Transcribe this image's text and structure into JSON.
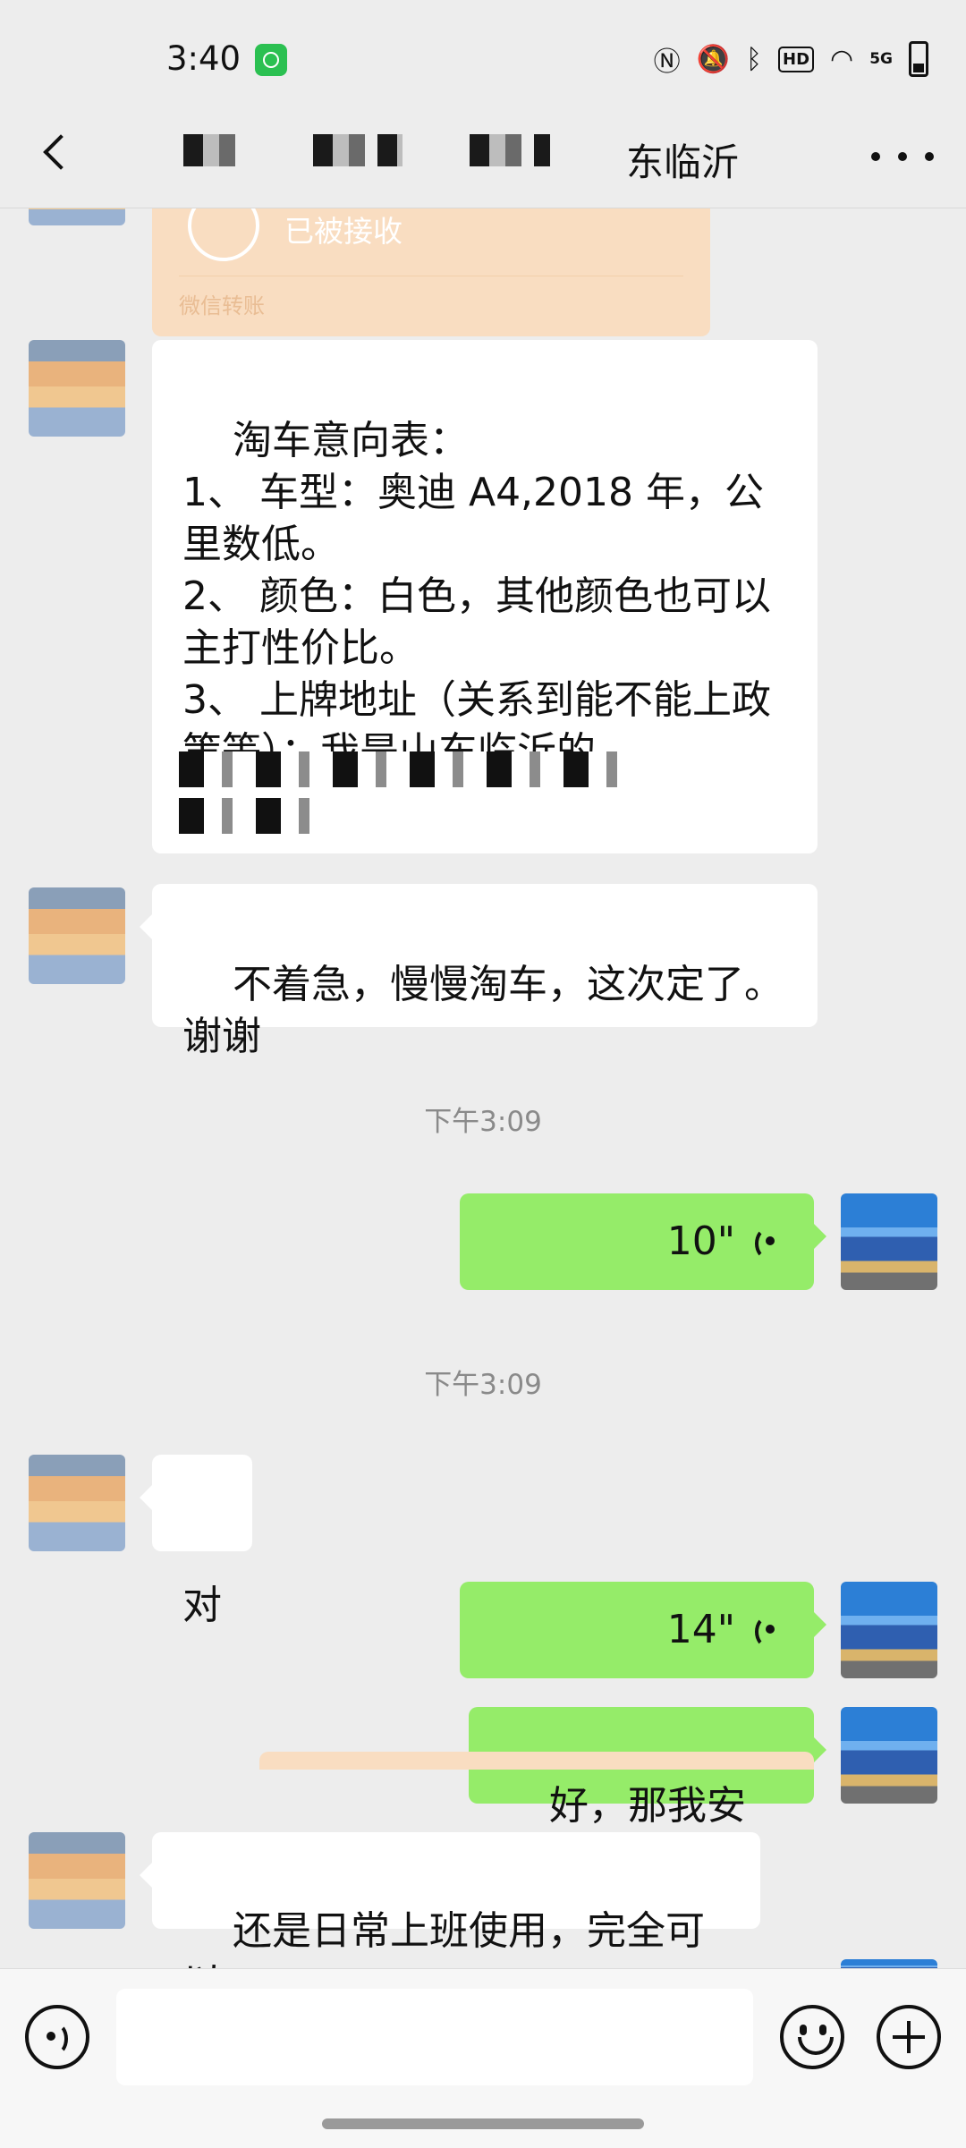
{
  "status_bar": {
    "time": "3:40",
    "icons": [
      "nfc-icon",
      "mute-icon",
      "bluetooth-icon",
      "hd-icon",
      "wifi-icon",
      "5g-signal-icon",
      "battery-icon"
    ],
    "hd": "HD",
    "network": "5G"
  },
  "header": {
    "title_visible": "东临沂",
    "back": "back-arrow-icon",
    "more": "more-icon"
  },
  "transfer": {
    "status": "已被接收",
    "label": "微信转账"
  },
  "messages": {
    "m1": "淘车意向表：\n1、 车型：奥迪 A4,2018 年，公里数低。\n2、 颜色：白色，其他颜色也可以主打性价比。\n3、 上牌地址（关系到能不能上政策等）：我是山东临沂的。",
    "m2": "不着急，慢慢淘车，这次定了。谢谢",
    "time1": "下午3:09",
    "v1": "10\"",
    "time2": "下午3:09",
    "m3": "对",
    "v2": "14\"",
    "m4": "好，那我安排下",
    "m5": "还是日常上班使用，完全可以。"
  },
  "input": {
    "value": "",
    "placeholder": ""
  },
  "colors": {
    "bg": "#ededed",
    "bubble_self": "#95ec69",
    "bubble_other": "#ffffff",
    "transfer": "#f9ddc1"
  }
}
